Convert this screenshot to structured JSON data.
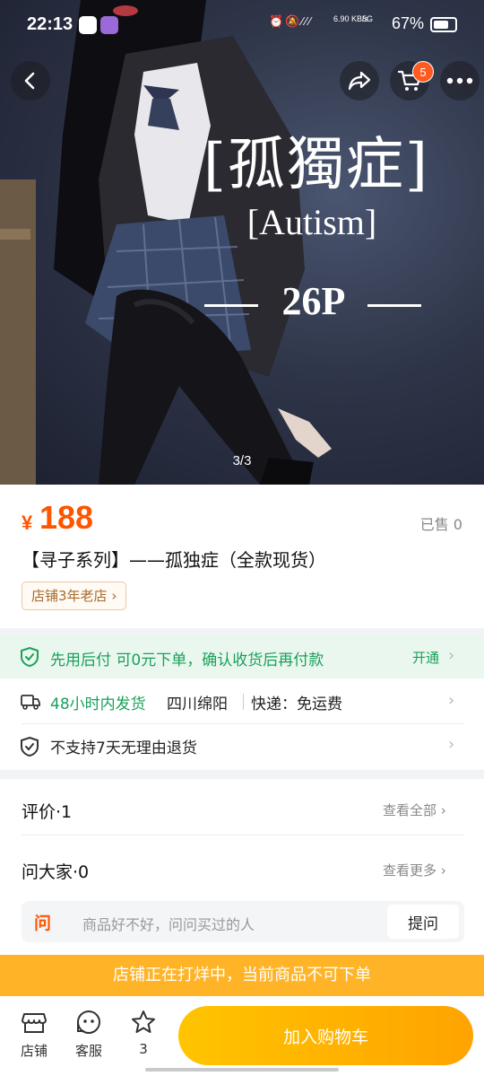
{
  "status_bar": {
    "time": "22:13",
    "net_speed": "6.90 KB/s",
    "network": "5G",
    "battery": "67%"
  },
  "nav": {
    "cart_count": "5"
  },
  "poster": {
    "title_cn": "[孤獨症]",
    "title_en": "[Autism]",
    "count": "26P",
    "image_index": "3/3"
  },
  "product": {
    "currency": "¥",
    "price": "188",
    "sold": "已售 0",
    "title": "【寻子系列】——孤独症（全款现货）",
    "shop_tag": "店铺3年老店"
  },
  "paylater": {
    "text": "先用后付 可0元下单，确认收货后再付款",
    "action": "开通"
  },
  "shipping": {
    "time": "48小时内发货",
    "location": "四川绵阳",
    "fee": "快递：免运费",
    "return_policy": "不支持7天无理由退货"
  },
  "reviews": {
    "title": "评价·1",
    "view_all": "查看全部"
  },
  "qa": {
    "title": "问大家·0",
    "view_more": "查看更多",
    "icon_text": "问",
    "placeholder": "商品好不好，问问买过的人",
    "ask_button": "提问"
  },
  "notice": "店铺正在打烊中，当前商品不可下单",
  "bottom_bar": {
    "shop": "店铺",
    "service": "客服",
    "favorites": "3",
    "add_to_cart": "加入购物车"
  },
  "colors": {
    "price": "#ff5500",
    "green": "#1aa05a",
    "notice_bg": "#ffb428",
    "cta_start": "#ffc400",
    "cta_end": "#ffa300"
  }
}
